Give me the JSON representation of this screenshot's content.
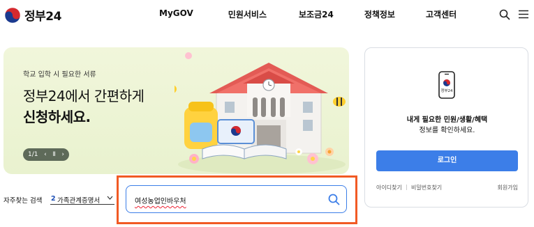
{
  "header": {
    "logo_text": "정부24",
    "nav": [
      "MyGOV",
      "민원서비스",
      "보조금24",
      "정책정보",
      "고객센터"
    ],
    "icons": [
      "search-icon",
      "menu-icon"
    ]
  },
  "banner": {
    "eyebrow": "학교 입학 시 필요한 서류",
    "title_line1": "정부24에서 간편하게",
    "title_line2": "신청하세요.",
    "pager": "1/1",
    "prev": "‹",
    "pause": "Ⅱ",
    "next": "›"
  },
  "login": {
    "message_line1": "내게 필요한 민원/생활/혜택",
    "message_line2": "정보를 확인하세요.",
    "login_button": "로그인",
    "find_id": "아이디찾기",
    "find_pw": "비밀번호찾기",
    "join": "회원가입"
  },
  "frequent": {
    "label": "자주찾는 검색",
    "rank": "2",
    "term": "가족관계증명서"
  },
  "search": {
    "value": "여성농업인바우처"
  },
  "colors": {
    "accent": "#3c7ee8",
    "highlight": "#f15a24",
    "banner_bg": "#eef5d6"
  }
}
